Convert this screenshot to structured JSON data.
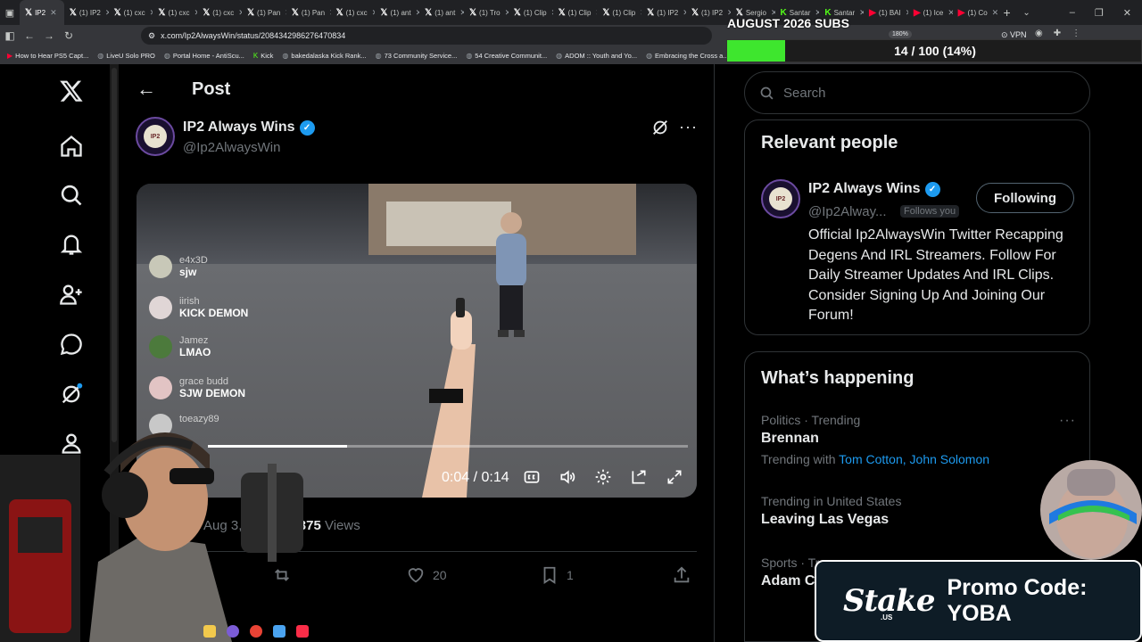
{
  "browser": {
    "tabs": [
      {
        "icon": "x-logo",
        "label": "IP2",
        "active": true
      },
      {
        "icon": "x-logo",
        "label": "(1) IP2"
      },
      {
        "icon": "x-logo",
        "label": "(1) cxc"
      },
      {
        "icon": "x-logo",
        "label": "(1) cxc"
      },
      {
        "icon": "x-logo",
        "label": "(1) cxc"
      },
      {
        "icon": "x-logo",
        "label": "(1) Pan"
      },
      {
        "icon": "x-logo",
        "label": "(1) Pan"
      },
      {
        "icon": "x-logo",
        "label": "(1) cxc"
      },
      {
        "icon": "x-logo",
        "label": "(1) ant"
      },
      {
        "icon": "x-logo",
        "label": "(1) ant"
      },
      {
        "icon": "x-logo",
        "label": "(1) Tro"
      },
      {
        "icon": "x-logo",
        "label": "(1) Clip"
      },
      {
        "icon": "x-logo",
        "label": "(1) Clip"
      },
      {
        "icon": "x-logo",
        "label": "(1) Clip"
      },
      {
        "icon": "x-logo",
        "label": "(1) IP2"
      },
      {
        "icon": "x-logo",
        "label": "(1) IP2"
      },
      {
        "icon": "x-logo",
        "label": "Sergio"
      },
      {
        "icon": "kick-logo",
        "label": "Santar"
      },
      {
        "icon": "kick-logo",
        "label": "Santar"
      },
      {
        "icon": "youtube-logo",
        "label": "(1) BAI"
      },
      {
        "icon": "youtube-logo",
        "label": "(1) Ice"
      },
      {
        "icon": "youtube-logo",
        "label": "(1) Co"
      }
    ],
    "url": "x.com/Ip2AlwaysWin/status/2084342986276470834",
    "zoom": "180%",
    "vpn_label": "VPN",
    "bookmarks": [
      {
        "icon": "youtube-logo",
        "label": "How to Hear PS5 Capt..."
      },
      {
        "icon": "globe-icon",
        "label": "LiveU Solo PRO"
      },
      {
        "icon": "globe-icon",
        "label": "Portal Home - AntiScu..."
      },
      {
        "icon": "kick-logo",
        "label": "Kick"
      },
      {
        "icon": "globe-icon",
        "label": "bakedalaska Kick Rank..."
      },
      {
        "icon": "globe-icon",
        "label": "73 Community Service..."
      },
      {
        "icon": "globe-icon",
        "label": "54 Creative Communit..."
      },
      {
        "icon": "globe-icon",
        "label": "ADOM :: Youth and Yo..."
      },
      {
        "icon": "globe-icon",
        "label": "Embracing the Cross a..."
      }
    ]
  },
  "page": {
    "title": "Post",
    "author": {
      "name": "IP2 Always Wins",
      "handle": "@Ip2AlwaysWin",
      "avatar_text": "IP2"
    },
    "video": {
      "chat": [
        {
          "user": "e4x3D",
          "message": "sjw"
        },
        {
          "user": "iirish",
          "message": "KICK DEMON"
        },
        {
          "user": "Jamez",
          "message": "LMAO"
        },
        {
          "user": "grace budd",
          "message": "SJW DEMON"
        },
        {
          "user": "toeazy89",
          "message": ""
        }
      ],
      "time_current": "0:04",
      "time_total": "0:14",
      "time_display": "0:04 / 0:14",
      "progress_fraction": 0.29
    },
    "meta": {
      "date": "Aug 3, 2026",
      "separator": "·",
      "views": "1,375",
      "views_label": "Views"
    },
    "actions": {
      "likes": "20",
      "bookmarks": "1"
    }
  },
  "sidebar": {
    "search_placeholder": "Search",
    "relevant": {
      "title": "Relevant people",
      "name": "IP2 Always Wins",
      "handle": "@Ip2Alway...",
      "follows_you": "Follows you",
      "follow_button": "Following",
      "bio": "Official Ip2AlwaysWin Twitter Recapping Degens And IRL Streamers. Follow For Daily Streamer Updates And IRL Clips. Consider Signing Up And Joining Our Forum!"
    },
    "trends": {
      "title": "What’s happening",
      "items": [
        {
          "meta": "Politics · Trending",
          "name": "Brennan",
          "with_label": "Trending with",
          "with_links": "Tom Cotton, John Solomon"
        },
        {
          "meta": "Trending in United States",
          "name": "Leaving Las Vegas"
        },
        {
          "meta": "Sports · Tr",
          "name": "Adam C"
        }
      ]
    }
  },
  "overlay": {
    "subs_title": "AUGUST 2026 SUBS",
    "subs_progress": "14 / 100 (14%)",
    "subs_fraction": 0.14,
    "promo_logo": "Stake",
    "promo_logo_sub": ".US",
    "promo_text": "Promo Code: YOBA"
  },
  "colors": {
    "accent": "#1d9bf0",
    "bg": "#000000",
    "muted": "#71767b",
    "subs_fill": "#3ee62e"
  }
}
